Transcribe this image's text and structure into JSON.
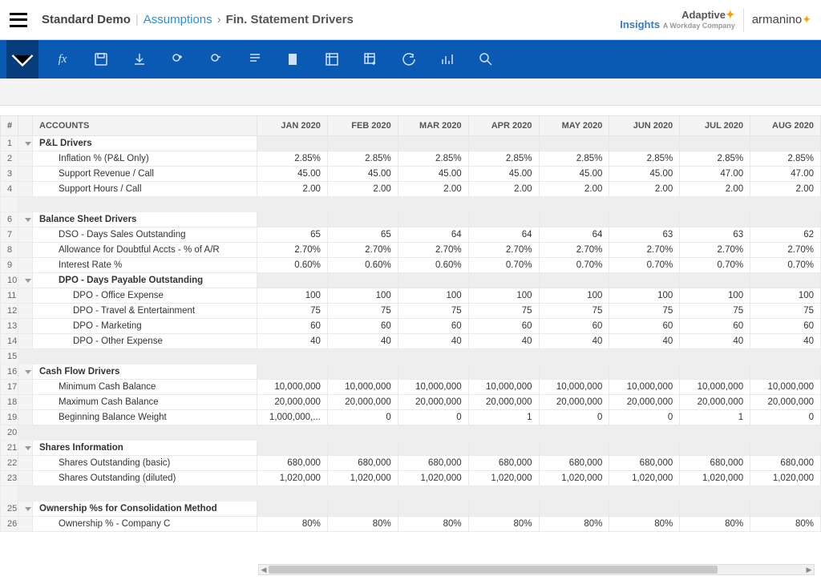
{
  "breadcrumb": {
    "demo": "Standard Demo",
    "link": "Assumptions",
    "sep": "›",
    "current": "Fin. Statement Drivers"
  },
  "logos": {
    "adaptive1": "Adaptive",
    "adaptive2": "Insights",
    "adaptive3": "A Workday Company",
    "armanino": "armanino"
  },
  "columns": [
    "#",
    "",
    "ACCOUNTS",
    "JAN 2020",
    "FEB 2020",
    "MAR 2020",
    "APR 2020",
    "MAY 2020",
    "JUN 2020",
    "JUL 2020",
    "AUG 2020"
  ],
  "rows": [
    {
      "n": 1,
      "type": "sec",
      "label": "P&L Drivers",
      "vals": [
        "",
        "",
        "",
        "",
        "",
        "",
        "",
        ""
      ]
    },
    {
      "n": 2,
      "type": "ind1",
      "label": "Inflation % (P&L Only)",
      "vals": [
        "2.85%",
        "2.85%",
        "2.85%",
        "2.85%",
        "2.85%",
        "2.85%",
        "2.85%",
        "2.85%"
      ]
    },
    {
      "n": 3,
      "type": "ind1",
      "label": "Support Revenue / Call",
      "vals": [
        "45.00",
        "45.00",
        "45.00",
        "45.00",
        "45.00",
        "45.00",
        "47.00",
        "47.00"
      ]
    },
    {
      "n": 4,
      "type": "ind1",
      "label": "Support Hours / Call",
      "vals": [
        "2.00",
        "2.00",
        "2.00",
        "2.00",
        "2.00",
        "2.00",
        "2.00",
        "2.00"
      ]
    },
    {
      "n": "",
      "type": "spacer",
      "label": "",
      "vals": [
        "",
        "",
        "",
        "",
        "",
        "",
        "",
        ""
      ]
    },
    {
      "n": 6,
      "type": "sec",
      "label": "Balance Sheet Drivers",
      "vals": [
        "",
        "",
        "",
        "",
        "",
        "",
        "",
        ""
      ]
    },
    {
      "n": 7,
      "type": "ind1",
      "label": "DSO - Days Sales Outstanding",
      "vals": [
        "65",
        "65",
        "64",
        "64",
        "64",
        "63",
        "63",
        "62"
      ]
    },
    {
      "n": 8,
      "type": "ind1",
      "label": "Allowance for Doubtful Accts - % of A/R",
      "vals": [
        "2.70%",
        "2.70%",
        "2.70%",
        "2.70%",
        "2.70%",
        "2.70%",
        "2.70%",
        "2.70%"
      ]
    },
    {
      "n": 9,
      "type": "ind1",
      "label": "Interest Rate %",
      "vals": [
        "0.60%",
        "0.60%",
        "0.60%",
        "0.70%",
        "0.70%",
        "0.70%",
        "0.70%",
        "0.70%"
      ]
    },
    {
      "n": 10,
      "type": "sec1",
      "label": "DPO - Days Payable Outstanding",
      "vals": [
        "",
        "",
        "",
        "",
        "",
        "",
        "",
        ""
      ]
    },
    {
      "n": 11,
      "type": "ind2",
      "label": "DPO - Office Expense",
      "vals": [
        "100",
        "100",
        "100",
        "100",
        "100",
        "100",
        "100",
        "100"
      ]
    },
    {
      "n": 12,
      "type": "ind2",
      "label": "DPO - Travel & Entertainment",
      "vals": [
        "75",
        "75",
        "75",
        "75",
        "75",
        "75",
        "75",
        "75"
      ]
    },
    {
      "n": 13,
      "type": "ind2",
      "label": "DPO - Marketing",
      "vals": [
        "60",
        "60",
        "60",
        "60",
        "60",
        "60",
        "60",
        "60"
      ]
    },
    {
      "n": 14,
      "type": "ind2",
      "label": "DPO - Other Expense",
      "vals": [
        "40",
        "40",
        "40",
        "40",
        "40",
        "40",
        "40",
        "40"
      ]
    },
    {
      "n": 15,
      "type": "spacer",
      "label": "",
      "vals": [
        "",
        "",
        "",
        "",
        "",
        "",
        "",
        ""
      ]
    },
    {
      "n": 16,
      "type": "sec",
      "label": "Cash Flow Drivers",
      "vals": [
        "",
        "",
        "",
        "",
        "",
        "",
        "",
        ""
      ]
    },
    {
      "n": 17,
      "type": "ind1",
      "label": "Minimum Cash Balance",
      "vals": [
        "10,000,000",
        "10,000,000",
        "10,000,000",
        "10,000,000",
        "10,000,000",
        "10,000,000",
        "10,000,000",
        "10,000,000"
      ]
    },
    {
      "n": 18,
      "type": "ind1",
      "label": "Maximum Cash Balance",
      "vals": [
        "20,000,000",
        "20,000,000",
        "20,000,000",
        "20,000,000",
        "20,000,000",
        "20,000,000",
        "20,000,000",
        "20,000,000"
      ]
    },
    {
      "n": 19,
      "type": "ind1",
      "label": "Beginning Balance Weight",
      "vals": [
        "1,000,000,...",
        "0",
        "0",
        "1",
        "0",
        "0",
        "1",
        "0"
      ]
    },
    {
      "n": 20,
      "type": "spacer",
      "label": "",
      "vals": [
        "",
        "",
        "",
        "",
        "",
        "",
        "",
        ""
      ]
    },
    {
      "n": 21,
      "type": "sec",
      "label": "Shares Information",
      "vals": [
        "",
        "",
        "",
        "",
        "",
        "",
        "",
        ""
      ]
    },
    {
      "n": 22,
      "type": "ind1",
      "label": "Shares Outstanding (basic)",
      "vals": [
        "680,000",
        "680,000",
        "680,000",
        "680,000",
        "680,000",
        "680,000",
        "680,000",
        "680,000"
      ]
    },
    {
      "n": 23,
      "type": "ind1",
      "label": "Shares Outstanding (diluted)",
      "vals": [
        "1,020,000",
        "1,020,000",
        "1,020,000",
        "1,020,000",
        "1,020,000",
        "1,020,000",
        "1,020,000",
        "1,020,000"
      ]
    },
    {
      "n": "",
      "type": "spacer",
      "label": "",
      "vals": [
        "",
        "",
        "",
        "",
        "",
        "",
        "",
        ""
      ]
    },
    {
      "n": 25,
      "type": "sec",
      "label": "Ownership %s for Consolidation Method",
      "vals": [
        "",
        "",
        "",
        "",
        "",
        "",
        "",
        ""
      ]
    },
    {
      "n": 26,
      "type": "ind1",
      "label": "Ownership % - Company C",
      "vals": [
        "80%",
        "80%",
        "80%",
        "80%",
        "80%",
        "80%",
        "80%",
        "80%"
      ]
    }
  ]
}
